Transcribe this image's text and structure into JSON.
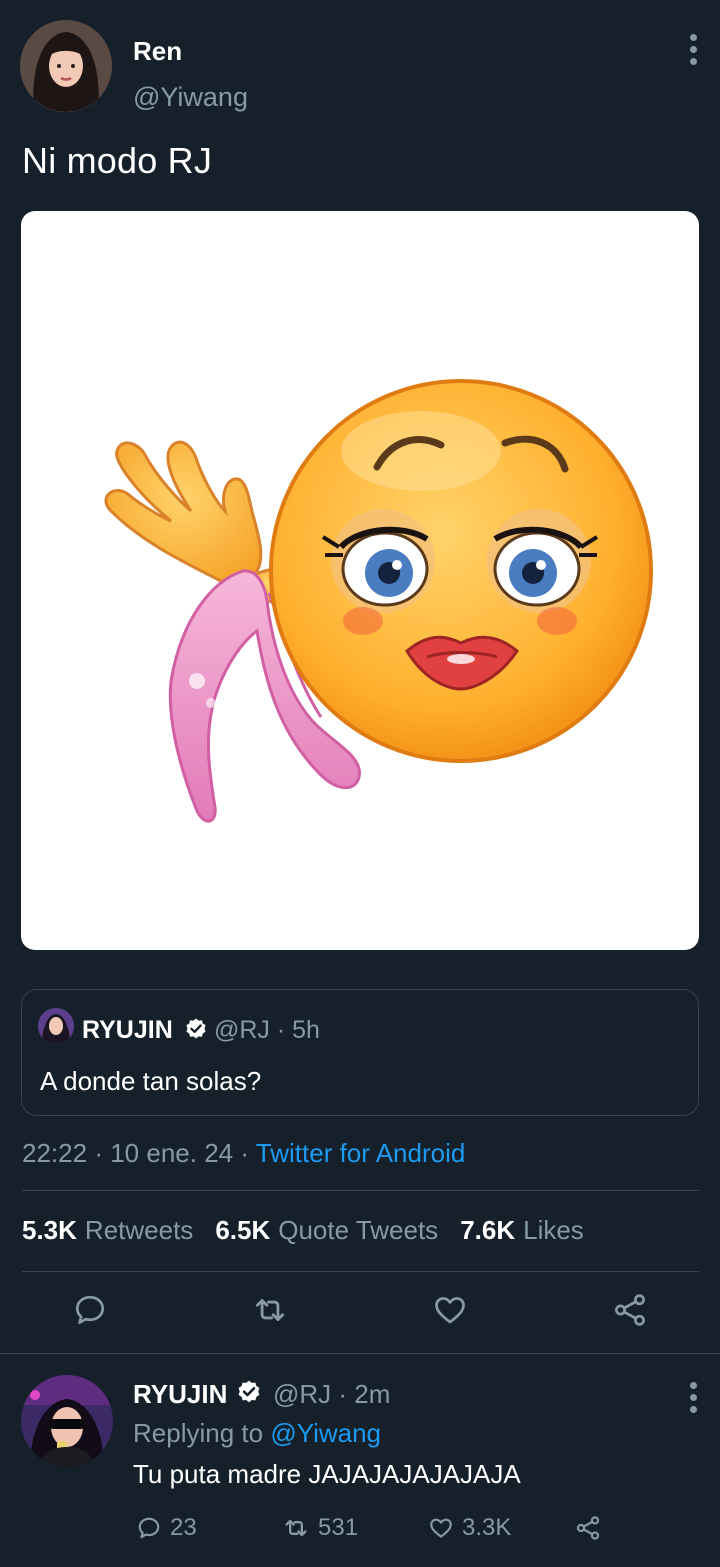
{
  "tweet": {
    "author": {
      "name": "Ren",
      "handle": "@Yiwang"
    },
    "text": "Ni modo RJ",
    "media": {
      "description_icon": "flirty-emoji-with-pink-underwear"
    },
    "quote": {
      "name": "RYUJIN",
      "handle_time": "@RJ · 5h",
      "text": "A donde tan solas?"
    },
    "time": "22:22",
    "date": "10 ene. 24",
    "separator": "·",
    "source": "Twitter for Android",
    "stats": {
      "retweets_count": "5.3K",
      "retweets_label": "Retweets",
      "quotes_count": "6.5K",
      "quotes_label": "Quote Tweets",
      "likes_count": "7.6K",
      "likes_label": "Likes"
    }
  },
  "reply": {
    "name": "RYUJIN",
    "handle_time": "@RJ · 2m",
    "replying_prefix": "Replying to",
    "replying_to": "@Yiwang",
    "text": "Tu puta madre JAJAJAJAJAJAJA",
    "replies": "23",
    "retweets": "531",
    "likes": "3.3K"
  },
  "colors": {
    "background": "#15202b",
    "secondary_text": "#8899a6",
    "accent": "#1d9bf0",
    "divider": "#38444d"
  }
}
